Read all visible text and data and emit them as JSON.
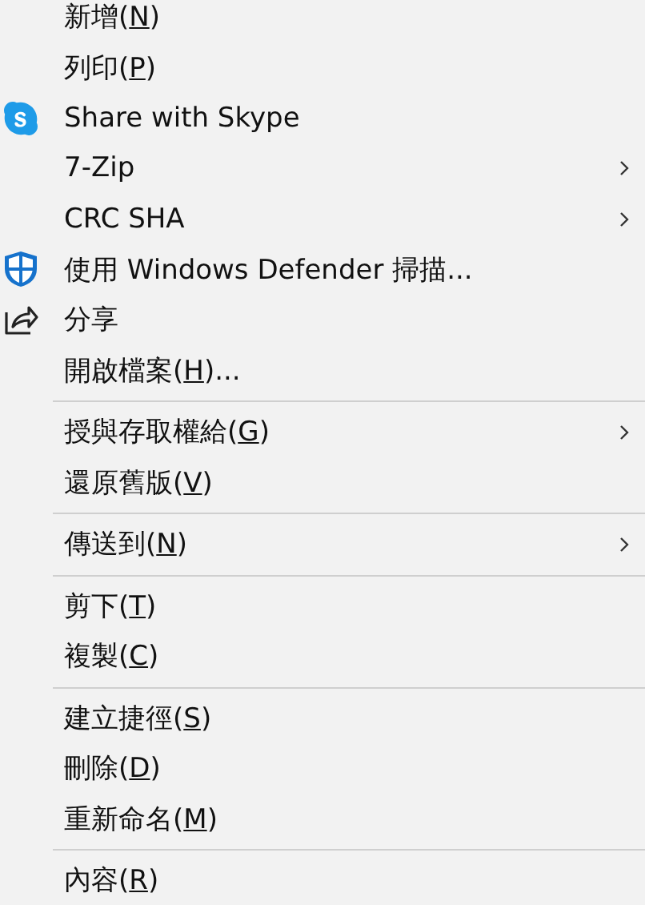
{
  "menu": {
    "items": [
      {
        "kind": "item",
        "before": "新增(",
        "key": "N",
        "after": ")",
        "submenu": false
      },
      {
        "kind": "item",
        "before": "列印(",
        "key": "P",
        "after": ")",
        "submenu": false
      },
      {
        "kind": "skype",
        "before": "Share with Skype",
        "submenu": false
      },
      {
        "kind": "item",
        "before": "7-Zip",
        "submenu": true
      },
      {
        "kind": "item",
        "before": "CRC SHA",
        "submenu": true
      },
      {
        "kind": "shield",
        "before": "使用 Windows Defender 掃描...",
        "submenu": false
      },
      {
        "kind": "share",
        "before": "分享",
        "submenu": false
      },
      {
        "kind": "item",
        "before": "開啟檔案(",
        "key": "H",
        "after": ")...",
        "submenu": false
      },
      {
        "kind": "separator"
      },
      {
        "kind": "item",
        "before": "授與存取權給(",
        "key": "G",
        "after": ")",
        "submenu": true
      },
      {
        "kind": "item",
        "before": "還原舊版(",
        "key": "V",
        "after": ")",
        "submenu": false
      },
      {
        "kind": "separator"
      },
      {
        "kind": "item",
        "before": "傳送到(",
        "key": "N",
        "after": ")",
        "submenu": true
      },
      {
        "kind": "separator"
      },
      {
        "kind": "item",
        "before": "剪下(",
        "key": "T",
        "after": ")",
        "submenu": false
      },
      {
        "kind": "item",
        "before": "複製(",
        "key": "C",
        "after": ")",
        "submenu": false
      },
      {
        "kind": "separator"
      },
      {
        "kind": "item",
        "before": "建立捷徑(",
        "key": "S",
        "after": ")",
        "submenu": false
      },
      {
        "kind": "item",
        "before": "刪除(",
        "key": "D",
        "after": ")",
        "submenu": false
      },
      {
        "kind": "item",
        "before": "重新命名(",
        "key": "M",
        "after": ")",
        "submenu": false
      },
      {
        "kind": "separator"
      },
      {
        "kind": "item",
        "before": "內容(",
        "key": "R",
        "after": ")",
        "submenu": false
      }
    ]
  }
}
